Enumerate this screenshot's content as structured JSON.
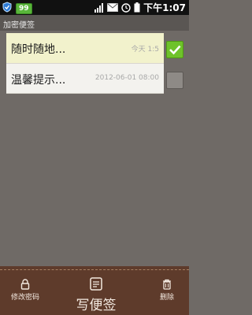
{
  "status_bar": {
    "battery_badge": "99",
    "time": "下午1:07"
  },
  "header": {
    "title": "加密便签"
  },
  "notes": [
    {
      "title": "随时随地...",
      "date": "今天 1:5",
      "checked": true
    },
    {
      "title": "温馨提示...",
      "date": "2012-06-01 08:00",
      "checked": false
    }
  ],
  "toolbar": {
    "change_password": "修改密码",
    "write_note": "写便签",
    "delete": "删除"
  },
  "colors": {
    "background": "#6f6a66",
    "selected_note": "#f2f2cc",
    "check_active": "#6ec22a",
    "toolbar": "#5e3b2b"
  },
  "icons": [
    "shield-icon",
    "signal-icon",
    "mail-icon",
    "alarm-icon",
    "battery-icon",
    "lock-icon",
    "note-icon",
    "trash-icon",
    "checkmark-icon"
  ]
}
